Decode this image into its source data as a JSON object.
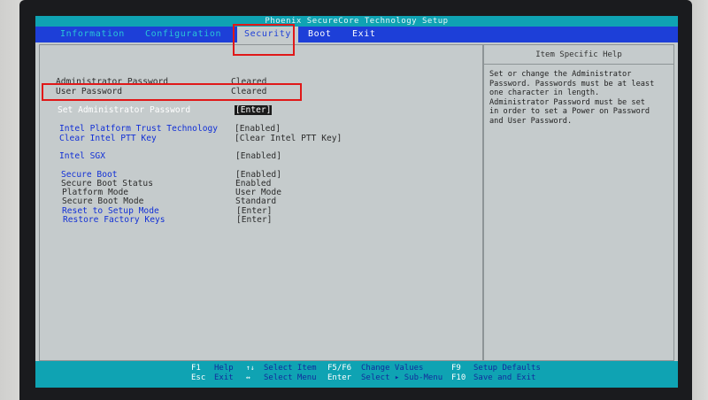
{
  "title": "Phoenix SecureCore Technology Setup",
  "menu": {
    "items": [
      {
        "label": "Information"
      },
      {
        "label": "Configuration"
      },
      {
        "label": "Security"
      },
      {
        "label": "Boot"
      },
      {
        "label": "Exit"
      }
    ],
    "active": "Security"
  },
  "settings": {
    "admin_pw": {
      "label": "Administrator Password",
      "value": "Cleared"
    },
    "user_pw": {
      "label": "User Password",
      "value": "Cleared"
    },
    "set_admin_pw": {
      "label": "Set Administrator Password",
      "value": "[Enter]"
    },
    "ptt": {
      "label": "Intel Platform Trust Technology",
      "value": "[Enabled]"
    },
    "clear_ptt": {
      "label": "Clear Intel PTT Key",
      "value": "[Clear Intel PTT Key]"
    },
    "sgx": {
      "label": "Intel SGX",
      "value": "[Enabled]"
    },
    "secure_boot": {
      "label": "Secure Boot",
      "value": "[Enabled]"
    },
    "secure_boot_status": {
      "label": "Secure Boot Status",
      "value": "Enabled"
    },
    "platform_mode": {
      "label": "Platform Mode",
      "value": "User Mode"
    },
    "secure_boot_mode": {
      "label": "Secure Boot Mode",
      "value": "Standard"
    },
    "reset_setup": {
      "label": "Reset to Setup Mode",
      "value": "[Enter]"
    },
    "restore_keys": {
      "label": "Restore Factory Keys",
      "value": "[Enter]"
    }
  },
  "help": {
    "header": "Item Specific Help",
    "lines": [
      "Set or change the Administrator",
      "Password. Passwords must be at least",
      "one character in length.",
      "Administrator Password must be set",
      "in order to set a Power on Password",
      "and User Password."
    ]
  },
  "footer": {
    "f1": {
      "key": "F1",
      "desc": "Help"
    },
    "esc": {
      "key": "Esc",
      "desc": "Exit"
    },
    "updown": {
      "key": "↑↓",
      "desc": "Select Item"
    },
    "leftright": {
      "key": "↔",
      "desc": "Select Menu"
    },
    "f5f6": {
      "key": "F5/F6",
      "desc": "Change Values"
    },
    "enter": {
      "key": "Enter",
      "desc": "Select ▸ Sub-Menu"
    },
    "f9": {
      "key": "F9",
      "desc": "Setup Defaults"
    },
    "f10": {
      "key": "F10",
      "desc": "Save and Exit"
    }
  },
  "colors": {
    "menubar": "#1d3fd8",
    "titlebar": "#0fa3b3",
    "background": "#c5cbcc",
    "annotation": "#e01818"
  }
}
